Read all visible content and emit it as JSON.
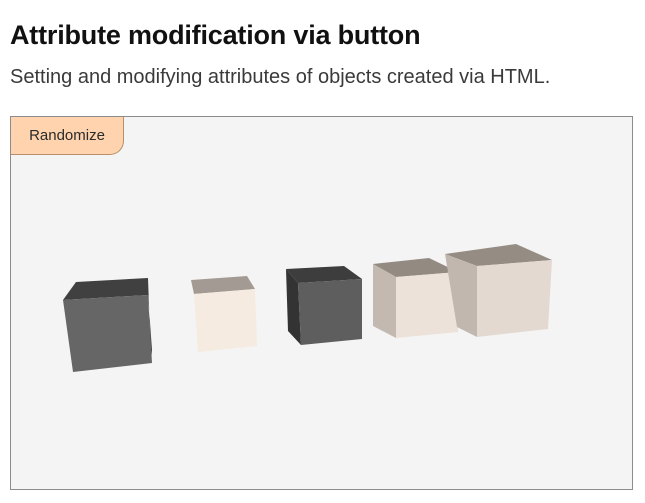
{
  "page": {
    "title": "Attribute modification via button",
    "subtitle": "Setting and modifying attributes of objects created via HTML."
  },
  "controls": {
    "randomize_label": "Randomize"
  },
  "scene": {
    "object_type": "cube",
    "object_count": 5,
    "cubes": [
      {
        "name": "cube-1",
        "color": "#666666"
      },
      {
        "name": "cube-2",
        "color": "#f5ebe1"
      },
      {
        "name": "cube-3",
        "color": "#5e5e5e"
      },
      {
        "name": "cube-4",
        "color": "#ece2d9"
      },
      {
        "name": "cube-5",
        "color": "#e4d9d1"
      }
    ]
  },
  "colors": {
    "button_background": "#fed3ad",
    "viewport_background": "#f4f4f4"
  }
}
